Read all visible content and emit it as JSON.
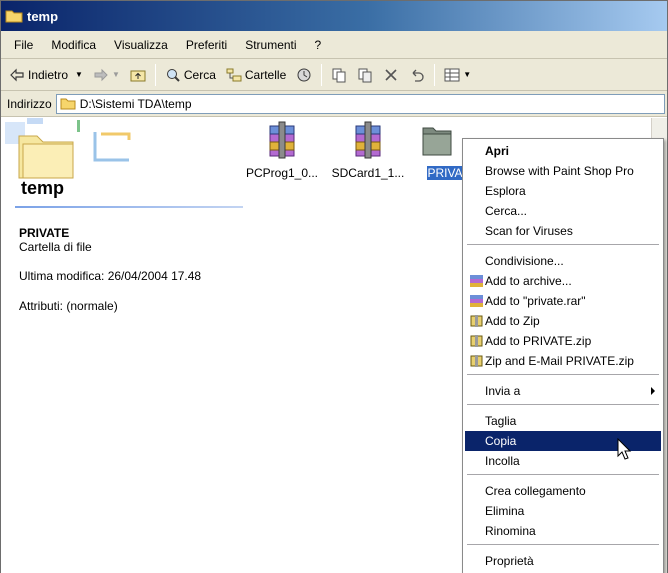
{
  "window": {
    "title": "temp"
  },
  "menubar": {
    "items": [
      "File",
      "Modifica",
      "Visualizza",
      "Preferiti",
      "Strumenti",
      "?"
    ]
  },
  "toolbar": {
    "back_label": "Indietro",
    "search_label": "Cerca",
    "folders_label": "Cartelle"
  },
  "address": {
    "label": "Indirizzo",
    "value": "D:\\Sistemi TDA\\temp"
  },
  "left_pane": {
    "folder_title": "temp",
    "selected_name": "PRIVATE",
    "selected_type": "Cartella di file",
    "modified": "Ultima modifica: 26/04/2004 17.48",
    "attributes": "Attributi: (normale)"
  },
  "files": [
    {
      "label": "PCProg1_0...",
      "icon": "winrar-archive-icon"
    },
    {
      "label": "SDCard1_1...",
      "icon": "winrar-archive-icon"
    },
    {
      "label": "PRIVA",
      "icon": "folder-icon"
    }
  ],
  "context_menu": {
    "open": "Apri",
    "browse_psp": "Browse with Paint Shop Pro",
    "explore": "Esplora",
    "search": "Cerca...",
    "scan_viruses": "Scan for Viruses",
    "share": "Condivisione...",
    "add_archive": "Add to archive...",
    "add_rar": "Add to \"private.rar\"",
    "add_zip": "Add to Zip",
    "add_private_zip": "Add to PRIVATE.zip",
    "zip_email": "Zip and E-Mail PRIVATE.zip",
    "send_to": "Invia a",
    "cut": "Taglia",
    "copy": "Copia",
    "paste": "Incolla",
    "create_shortcut": "Crea collegamento",
    "delete": "Elimina",
    "rename": "Rinomina",
    "properties": "Proprietà"
  },
  "colors": {
    "title_start": "#0a246a",
    "selection": "#316ac5",
    "menu_highlight": "#0a246a",
    "chrome": "#ece9d8"
  }
}
